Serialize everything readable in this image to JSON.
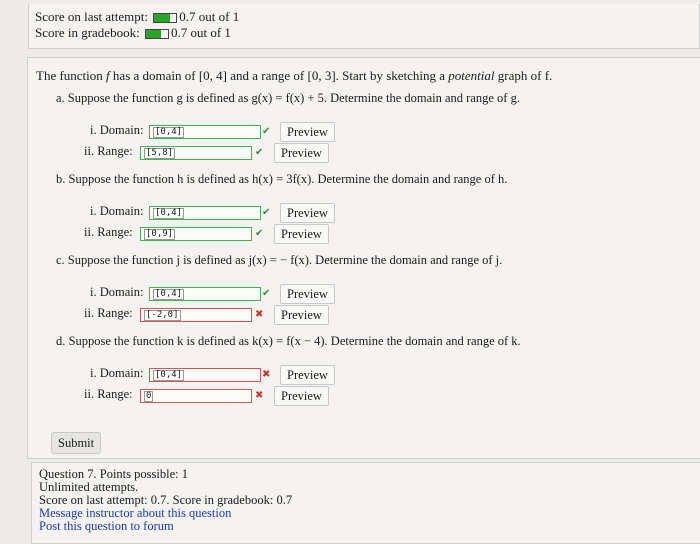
{
  "score": {
    "last_attempt_label": "Score on last attempt:",
    "last_attempt_value": "0.7 out of 1",
    "last_attempt_fraction": 0.7,
    "gradebook_label": "Score in gradebook:",
    "gradebook_value": "0.7 out of 1",
    "gradebook_fraction": 0.7,
    "bar_color": "#2aa52a"
  },
  "question": {
    "intro_prefix": "The function",
    "intro_f": "f",
    "intro_mid": "has a domain of [0, 4] and a range of [0, 3]. Start by sketching a",
    "intro_potential": "potential",
    "intro_suffix": "graph of f.",
    "parts": [
      {
        "prompt": "a. Suppose the function g is defined as g(x) = f(x) + 5. Determine the domain and range of g.",
        "domain_label": "i. Domain:",
        "domain_value": "[0,4]",
        "domain_status": "correct",
        "range_label": "ii. Range:",
        "range_value": "[5,8]",
        "range_status": "correct"
      },
      {
        "prompt": "b. Suppose the function h is defined as h(x) = 3f(x). Determine the domain and range of h.",
        "domain_label": "i. Domain:",
        "domain_value": "[0,4]",
        "domain_status": "correct",
        "range_label": "ii. Range:",
        "range_value": "[0,9]",
        "range_status": "correct"
      },
      {
        "prompt": "c. Suppose the function j is defined as j(x) = − f(x). Determine the domain and range of j.",
        "domain_label": "i. Domain:",
        "domain_value": "[0,4]",
        "domain_status": "correct",
        "range_label": "ii. Range:",
        "range_value": "[-2,0]",
        "range_status": "incorrect"
      },
      {
        "prompt": "d. Suppose the function k is defined as k(x) = f(x − 4). Determine the domain and range of k.",
        "domain_label": "i. Domain:",
        "domain_value": "[0,4]",
        "domain_status": "incorrect",
        "range_label": "ii. Range:",
        "range_value": "0",
        "range_status": "incorrect"
      }
    ],
    "preview_label": "Preview",
    "submit_label": "Submit",
    "correct_color": "#4caf50",
    "incorrect_color": "#d9534f"
  },
  "info": {
    "question_line": "Question 7. Points possible: 1",
    "attempts": "Unlimited attempts.",
    "score_line": "Score on last attempt: 0.7. Score in gradebook: 0.7",
    "message_link": "Message instructor about this question",
    "forum_link": "Post this question to forum"
  }
}
